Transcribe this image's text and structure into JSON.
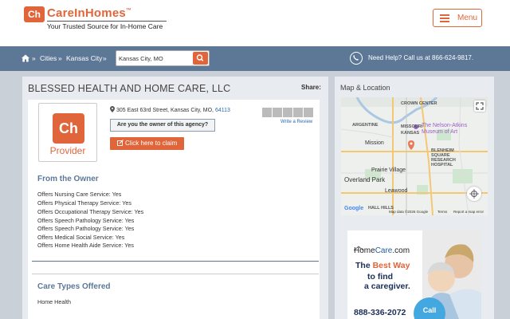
{
  "header": {
    "logo_mark": "Ch",
    "brand_name": "CareInHomes",
    "trademark": "™",
    "tagline": "Your Trusted Source for In-Home Care",
    "menu_label": "Menu"
  },
  "nav": {
    "breadcrumb": [
      {
        "label": "Cities"
      },
      {
        "label": "Kansas City"
      }
    ],
    "separator": "»",
    "search_value": "Kansas City, MO",
    "help_text": "Need Help? Call us at 866-624-9817."
  },
  "listing": {
    "name": "BLESSED HEALTH AND HOME CARE, LLC",
    "share_label": "Share:",
    "provider_label": "Provider",
    "address": "305 East 63rd Street, Kansas City, MO,",
    "zip": "64113",
    "owner_question": "Are you the owner of this agency?",
    "claim_button": "Click here to claim",
    "rating_stars": 0,
    "write_review": "Write a Review"
  },
  "from_owner": {
    "title": "From the Owner",
    "services": [
      "Offers Nursing Care Service: Yes",
      "Offers Physical Therapy Service: Yes",
      "Offers Occupational Therapy Service: Yes",
      "Offers Speech Pathology Service: Yes",
      "Offers Speech Pathology Service: Yes",
      "Offers Medical Social Service: Yes",
      "Offers Home Health Aide Service: Yes"
    ]
  },
  "care_types": {
    "title": "Care Types Offered",
    "items": [
      "Home Health"
    ]
  },
  "sidebar": {
    "map_title": "Map & Location",
    "map_labels": {
      "crown_center": "CROWN CENTER",
      "argentine": "ARGENTINE",
      "missouri": "MISSOURI",
      "kansas": "KANSAS",
      "museum_line1": "The Nelson-Atkins",
      "museum_line2": "Museum of Art",
      "mission": "Mission",
      "blenheim1": "BLENHEIM",
      "blenheim2": "SQUARE",
      "blenheim3": "RESEARCH",
      "blenheim4": "HOSPITAL",
      "prairie_village": "Prairie Village",
      "overland_park": "Overland Park",
      "leawood": "Leawood",
      "hills": "HALL HILLS"
    },
    "map_footer": {
      "google": "Google",
      "map_data": "Map data ©2026 Google",
      "terms": "Terms",
      "report": "Report a map error"
    },
    "ad": {
      "brand_prefix": "Home",
      "brand_main": "Care",
      "brand_suffix": ".com",
      "line1_pre": "The ",
      "line1_accent": "Best Way",
      "line2": "to find",
      "line3": "a caregiver.",
      "phone": "888-336-2072",
      "call_label": "Call"
    }
  },
  "colors": {
    "brand_orange": "#e0653a",
    "nav_blue": "#5d7896",
    "link_blue": "#2a6ab3"
  }
}
